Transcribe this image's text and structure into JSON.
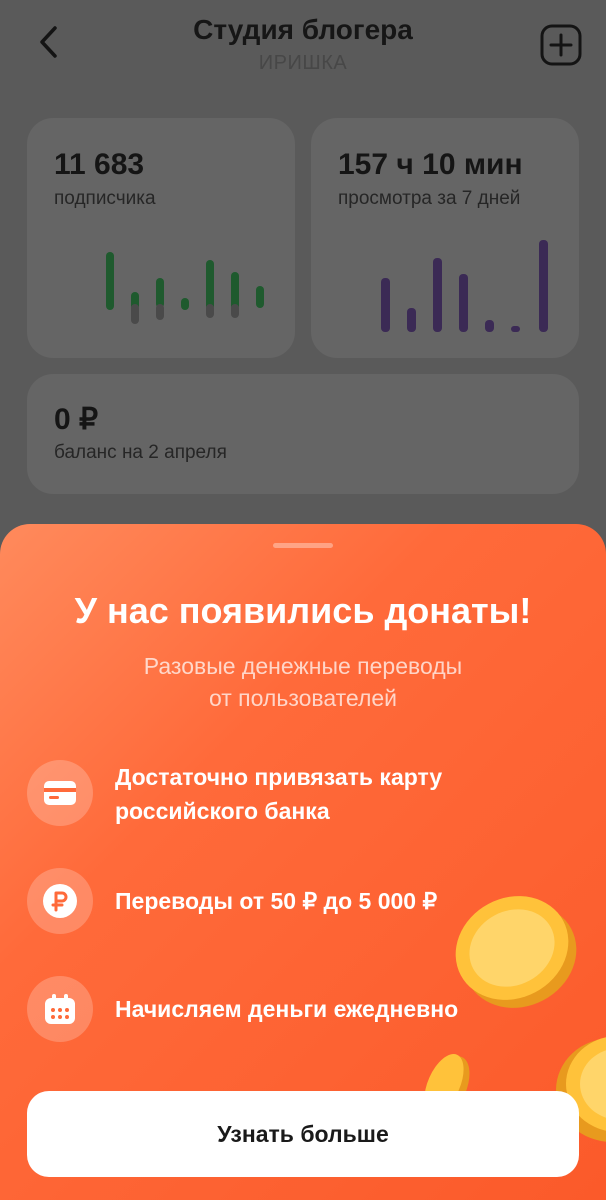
{
  "header": {
    "title": "Студия блогера",
    "subtitle": "ИРИШКА"
  },
  "stats": {
    "subscribers": {
      "value": "11 683",
      "label": "подписчика"
    },
    "views": {
      "value": "157 ч 10 мин",
      "label": "просмотра за 7 дней"
    },
    "balance": {
      "value": "0 ₽",
      "label": "баланс на 2 апреля"
    }
  },
  "promo": {
    "title": "У нас появились донаты!",
    "subtitle_line1": "Разовые денежные переводы",
    "subtitle_line2": "от пользователей",
    "features": [
      {
        "icon": "card-icon",
        "line1": "Достаточно привязать карту",
        "line2": "российского банка"
      },
      {
        "icon": "ruble-icon",
        "line1": "Переводы от 50 ₽ до 5 000 ₽"
      },
      {
        "icon": "calendar-icon",
        "line1": "Начисляем деньги ежедневно"
      }
    ],
    "cta_label": "Узнать больше"
  },
  "colors": {
    "subscribers_chart": "#1f5a2e",
    "views_chart": "#3b2a55",
    "accent": "#ff6a3a"
  }
}
